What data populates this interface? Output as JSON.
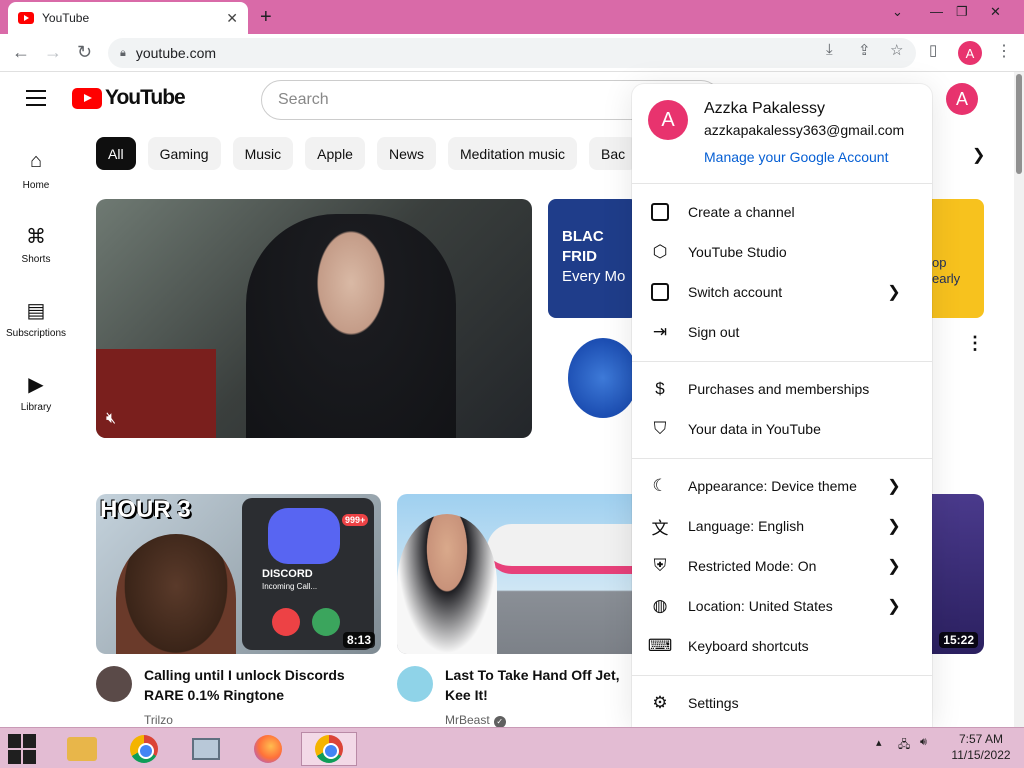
{
  "browser": {
    "tab_title": "YouTube",
    "tab_close": "✕",
    "new_tab": "+",
    "url": "youtube.com",
    "window_controls": {
      "minimize": "⌄",
      "restore": "❐",
      "close": "✕"
    },
    "profile_initial": "A"
  },
  "header": {
    "logo_text": "YouTube",
    "search_placeholder": "Search",
    "avatar_initial": "A"
  },
  "chips": [
    "All",
    "Gaming",
    "Music",
    "Apple",
    "News",
    "Meditation music",
    "Bac"
  ],
  "leftnav": [
    {
      "label": "Home",
      "icon": "home-icon"
    },
    {
      "label": "Shorts",
      "icon": "shorts-icon"
    },
    {
      "label": "Subscriptions",
      "icon": "subscriptions-icon"
    },
    {
      "label": "Library",
      "icon": "library-icon"
    }
  ],
  "ads": {
    "card_text_1": "BLAC",
    "card_text_2": "FRID",
    "card_text_3": "Every Mo",
    "card2_text_1": "op",
    "card2_text_2": "early"
  },
  "videos": [
    {
      "title": "Calling until I unlock Discords RARE 0.1% Ringtone",
      "channel": "Trilzo",
      "duration": "8:13",
      "thumb_text": "HOUR 3",
      "badge": "999+",
      "thumb_sub": "DISCORD",
      "thumb_sub2": "Incoming Call..."
    },
    {
      "title": "Last To Take Hand Off Jet, Kee It!",
      "channel": "MrBeast",
      "verified": "✓"
    },
    {
      "duration": "15:22"
    }
  ],
  "menu": {
    "name": "Azzka Pakalessy",
    "email": "azzkapakalessy363@gmail.com",
    "manage": "Manage your Google Account",
    "initial": "A",
    "group1": [
      {
        "label": "Create a channel",
        "icon": "person-box-icon",
        "chevron": false
      },
      {
        "label": "YouTube Studio",
        "icon": "studio-icon",
        "chevron": false
      },
      {
        "label": "Switch account",
        "icon": "switch-account-icon",
        "chevron": true
      },
      {
        "label": "Sign out",
        "icon": "sign-out-icon",
        "chevron": false
      }
    ],
    "group2": [
      {
        "label": "Purchases and memberships",
        "icon": "dollar-icon",
        "chevron": false
      },
      {
        "label": "Your data in YouTube",
        "icon": "shield-person-icon",
        "chevron": false
      }
    ],
    "group3": [
      {
        "label": "Appearance: Device theme",
        "icon": "moon-icon",
        "chevron": true
      },
      {
        "label": "Language: English",
        "icon": "translate-icon",
        "chevron": true
      },
      {
        "label": "Restricted Mode: On",
        "icon": "restricted-icon",
        "chevron": true
      },
      {
        "label": "Location: United States",
        "icon": "globe-icon",
        "chevron": true
      },
      {
        "label": "Keyboard shortcuts",
        "icon": "keyboard-icon",
        "chevron": false
      }
    ],
    "group4": [
      {
        "label": "Settings",
        "icon": "settings-icon",
        "chevron": false
      }
    ]
  },
  "taskbar": {
    "time": "7:57 AM",
    "date": "11/15/2022"
  },
  "colors": {
    "accent_pink": "#d96aa8",
    "avatar": "#e8336e",
    "link_blue": "#065fd4",
    "yt_red": "#ff0000"
  }
}
